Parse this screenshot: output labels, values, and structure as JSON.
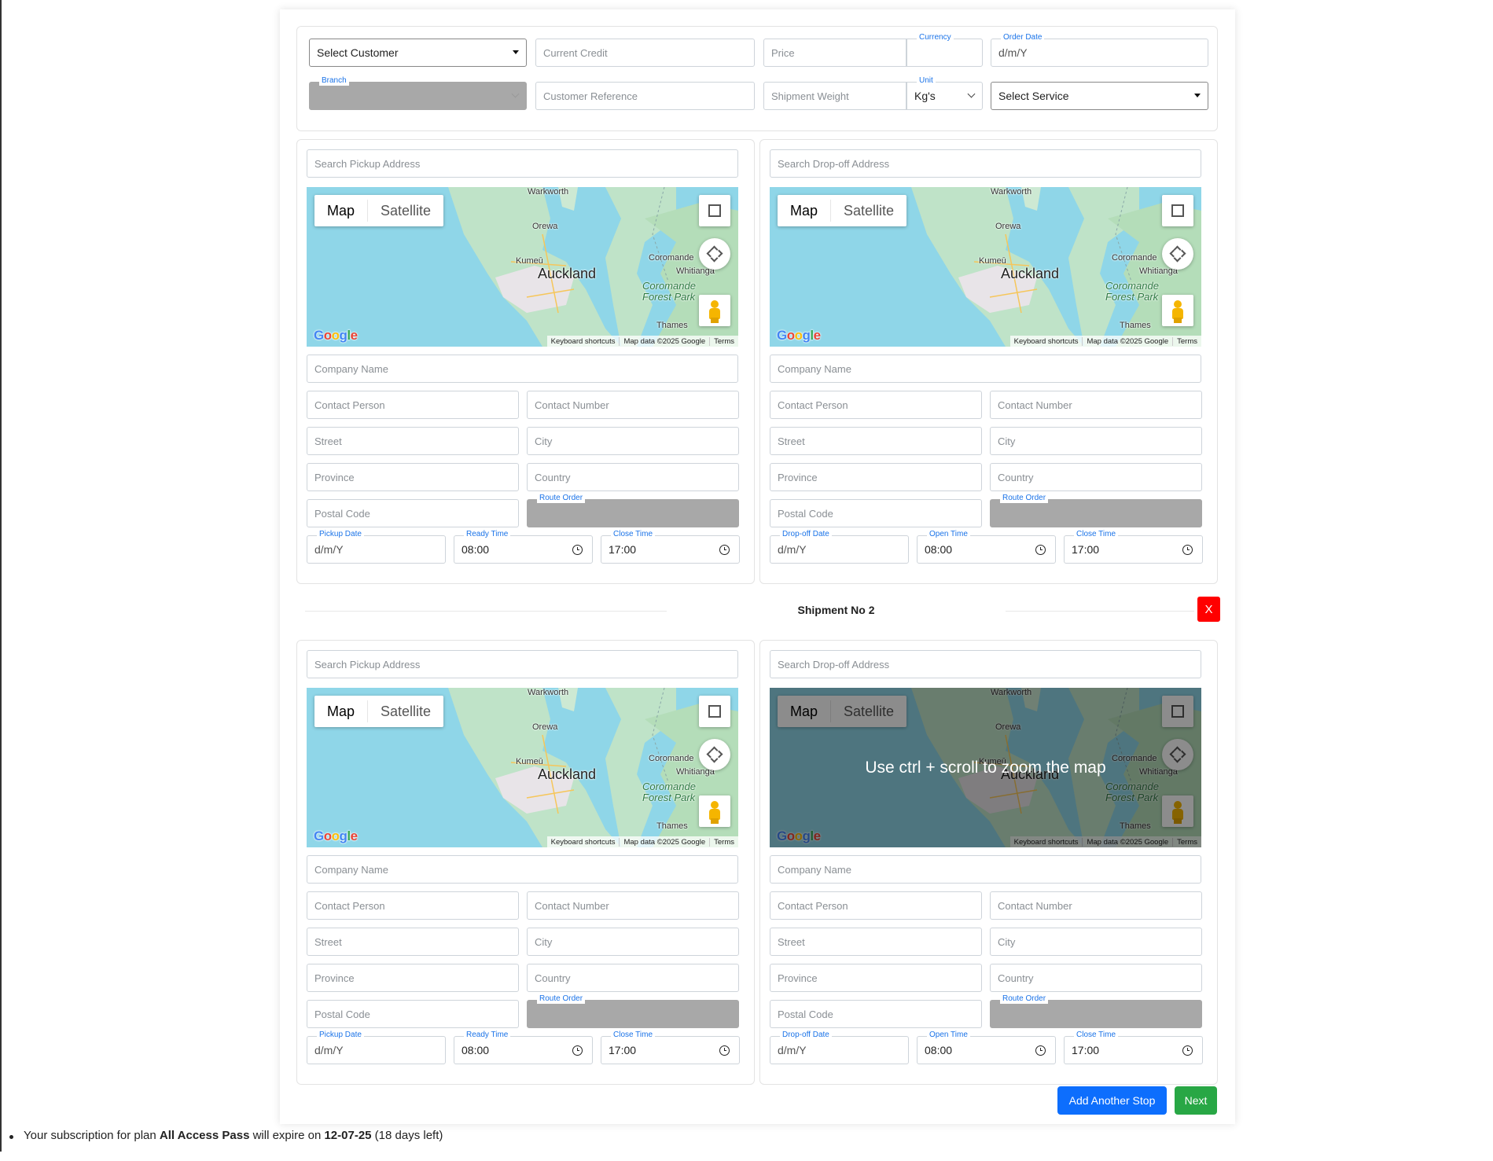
{
  "top_form": {
    "customer": {
      "value": "Select Customer"
    },
    "current_credit": {
      "placeholder": "Current Credit"
    },
    "price": {
      "placeholder": "Price"
    },
    "currency": {
      "label": "Currency",
      "value": ""
    },
    "order_date": {
      "label": "Order Date",
      "value": "d/m/Y"
    },
    "branch": {
      "label": "Branch"
    },
    "customer_reference": {
      "placeholder": "Customer Reference"
    },
    "shipment_weight": {
      "placeholder": "Shipment Weight"
    },
    "unit": {
      "label": "Unit",
      "value": "Kg's"
    },
    "service": {
      "value": "Select Service"
    }
  },
  "map": {
    "type_map": "Map",
    "type_satellite": "Satellite",
    "labels": [
      "Warkworth",
      "Orewa",
      "Kumeū",
      "Auckland",
      "Coromande",
      "Whitianga",
      "Coromande",
      "Forest Park",
      "Thames"
    ],
    "google": "Google",
    "attrib_shortcuts": "Keyboard shortcuts",
    "attrib_data": "Map data ©2025 Google",
    "attrib_terms": "Terms",
    "zoom_hint": "Use ctrl + scroll to zoom the map"
  },
  "pickup": {
    "search": "Search Pickup Address",
    "company": "Company Name",
    "contact_person": "Contact Person",
    "contact_number": "Contact Number",
    "street": "Street",
    "city": "City",
    "province": "Province",
    "country": "Country",
    "postal_code": "Postal Code",
    "route_order": "Route Order",
    "date_label": "Pickup Date",
    "date_value": "d/m/Y",
    "time1_label": "Ready Time",
    "time1_value": "08:00",
    "time2_label": "Close Time",
    "time2_value": "17:00"
  },
  "dropoff": {
    "search": "Search Drop-off Address",
    "company": "Company Name",
    "contact_person": "Contact Person",
    "contact_number": "Contact Number",
    "street": "Street",
    "city": "City",
    "province": "Province",
    "country": "Country",
    "postal_code": "Postal Code",
    "route_order": "Route Order",
    "date_label": "Drop-off Date",
    "date_value": "d/m/Y",
    "time1_label": "Open Time",
    "time1_value": "08:00",
    "time2_label": "Close Time",
    "time2_value": "17:00"
  },
  "shipment2": {
    "title": "Shipment No 2",
    "remove": "X"
  },
  "actions": {
    "add_stop": "Add Another Stop",
    "next": "Next",
    "add_color": "#0d6efd",
    "next_color": "#28a745"
  },
  "footer": {
    "prefix": "Your subscription for plan ",
    "plan": "All Access Pass",
    "middle": " will expire on ",
    "date": "12-07-25",
    "suffix": " (18 days left)"
  }
}
